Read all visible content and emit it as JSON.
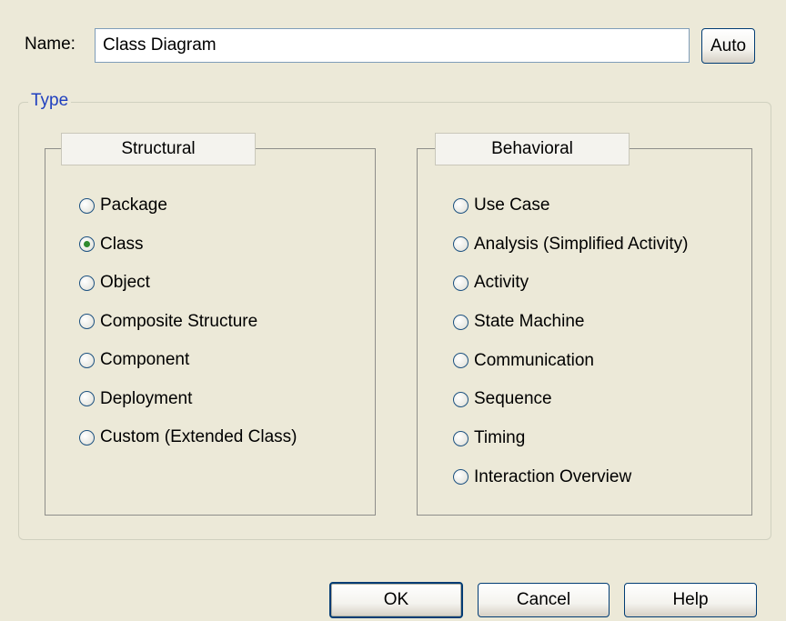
{
  "name": {
    "label": "Name:",
    "value": "Class Diagram",
    "auto_label": "Auto"
  },
  "type_label": "Type",
  "structural": {
    "title": "Structural",
    "options": [
      {
        "label": "Package",
        "selected": false
      },
      {
        "label": "Class",
        "selected": true
      },
      {
        "label": "Object",
        "selected": false
      },
      {
        "label": "Composite Structure",
        "selected": false
      },
      {
        "label": "Component",
        "selected": false
      },
      {
        "label": "Deployment",
        "selected": false
      },
      {
        "label": "Custom (Extended Class)",
        "selected": false
      }
    ]
  },
  "behavioral": {
    "title": "Behavioral",
    "options": [
      {
        "label": "Use Case",
        "selected": false
      },
      {
        "label": "Analysis (Simplified Activity)",
        "selected": false
      },
      {
        "label": "Activity",
        "selected": false
      },
      {
        "label": "State Machine",
        "selected": false
      },
      {
        "label": "Communication",
        "selected": false
      },
      {
        "label": "Sequence",
        "selected": false
      },
      {
        "label": "Timing",
        "selected": false
      },
      {
        "label": "Interaction Overview",
        "selected": false
      }
    ]
  },
  "buttons": {
    "ok": "OK",
    "cancel": "Cancel",
    "help": "Help"
  },
  "colors": {
    "dialog_bg": "#ece9d8",
    "accent": "#003c74",
    "group_title": "#1f3fbf",
    "radio_dot": "#2f8a2f"
  }
}
